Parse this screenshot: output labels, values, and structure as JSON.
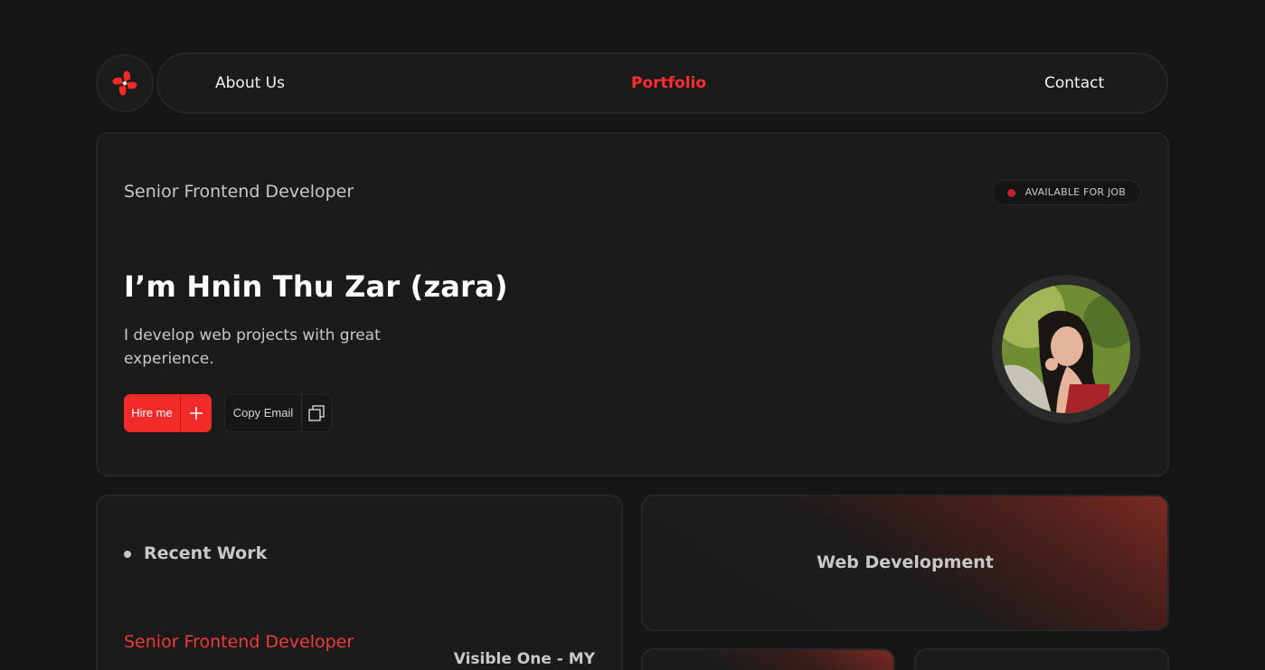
{
  "nav": {
    "links": [
      {
        "label": "About Us",
        "active": false
      },
      {
        "label": "Portfolio",
        "active": true
      },
      {
        "label": "Contact",
        "active": false
      }
    ],
    "logo_icon": "flower-logo-icon",
    "accent_color": "#ff2e2e"
  },
  "hero": {
    "role": "Senior Frontend Developer",
    "badge": "AVAILABLE FOR JOB",
    "name": "I’m Hnin Thu Zar (zara)",
    "description": "I develop web projects with great experience.",
    "hire_label": "Hire me",
    "copy_label": "Copy Email",
    "hire_icon": "plus-icon",
    "copy_icon": "copy-icon",
    "status_color": "#c0222b"
  },
  "recent": {
    "title": "Recent Work",
    "job_role": "Senior Frontend Developer",
    "job_company": "Visible One - MY"
  },
  "services": {
    "main": "Web Development"
  }
}
